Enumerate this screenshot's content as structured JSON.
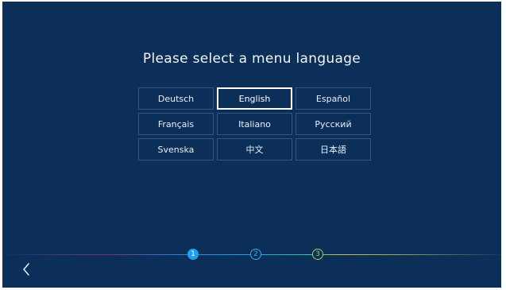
{
  "title": "Please select a menu language",
  "languages": [
    {
      "label": "Deutsch"
    },
    {
      "label": "English",
      "selected": true
    },
    {
      "label": "Español"
    },
    {
      "label": "Français"
    },
    {
      "label": "Italiano"
    },
    {
      "label": "Русский"
    },
    {
      "label": "Svenska"
    },
    {
      "label": "中文"
    },
    {
      "label": "日本語"
    }
  ],
  "steps": [
    "1",
    "2",
    "3"
  ],
  "current_step": 1,
  "icons": {
    "back": "chevron-left-icon"
  },
  "colors": {
    "background": "#0c2f5a",
    "selected_border": "#ffffff",
    "step_active": "#1ea0f0",
    "step_2": "#38a8e8",
    "step_3": "#a7cc4a"
  }
}
